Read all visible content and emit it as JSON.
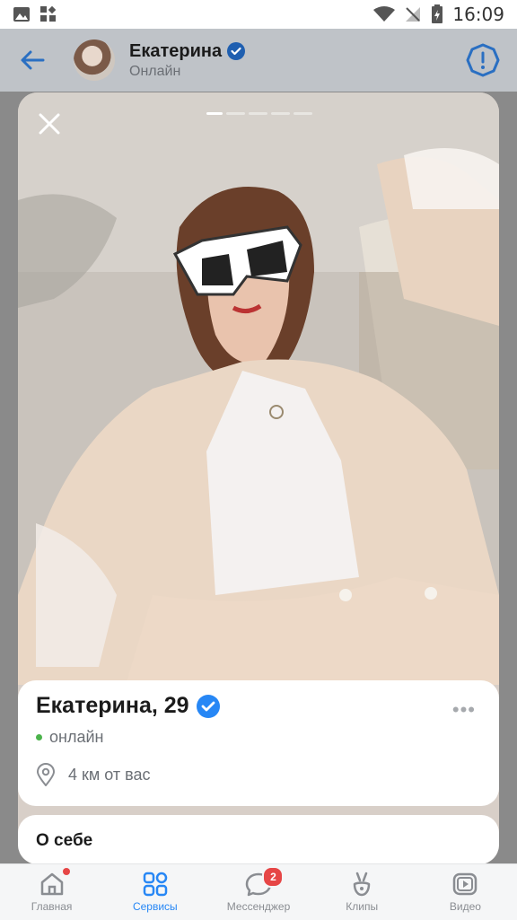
{
  "statusbar": {
    "time": "16:09"
  },
  "header": {
    "name": "Екатерина",
    "status": "Онлайн"
  },
  "profile": {
    "name_age": "Екатерина, 29",
    "online": "онлайн",
    "distance": "4 км от вас",
    "more": "•••",
    "photo_count": 5,
    "photo_index": 1
  },
  "about": {
    "title": "О себе"
  },
  "tabs": [
    {
      "label": "Главная",
      "icon": "home-icon"
    },
    {
      "label": "Сервисы",
      "icon": "services-icon"
    },
    {
      "label": "Мессенджер",
      "icon": "messenger-icon",
      "badge": "2"
    },
    {
      "label": "Клипы",
      "icon": "clips-icon"
    },
    {
      "label": "Видео",
      "icon": "video-icon"
    }
  ],
  "colors": {
    "accent": "#2787f5",
    "badge": "#e64646",
    "online": "#4bb34b"
  }
}
